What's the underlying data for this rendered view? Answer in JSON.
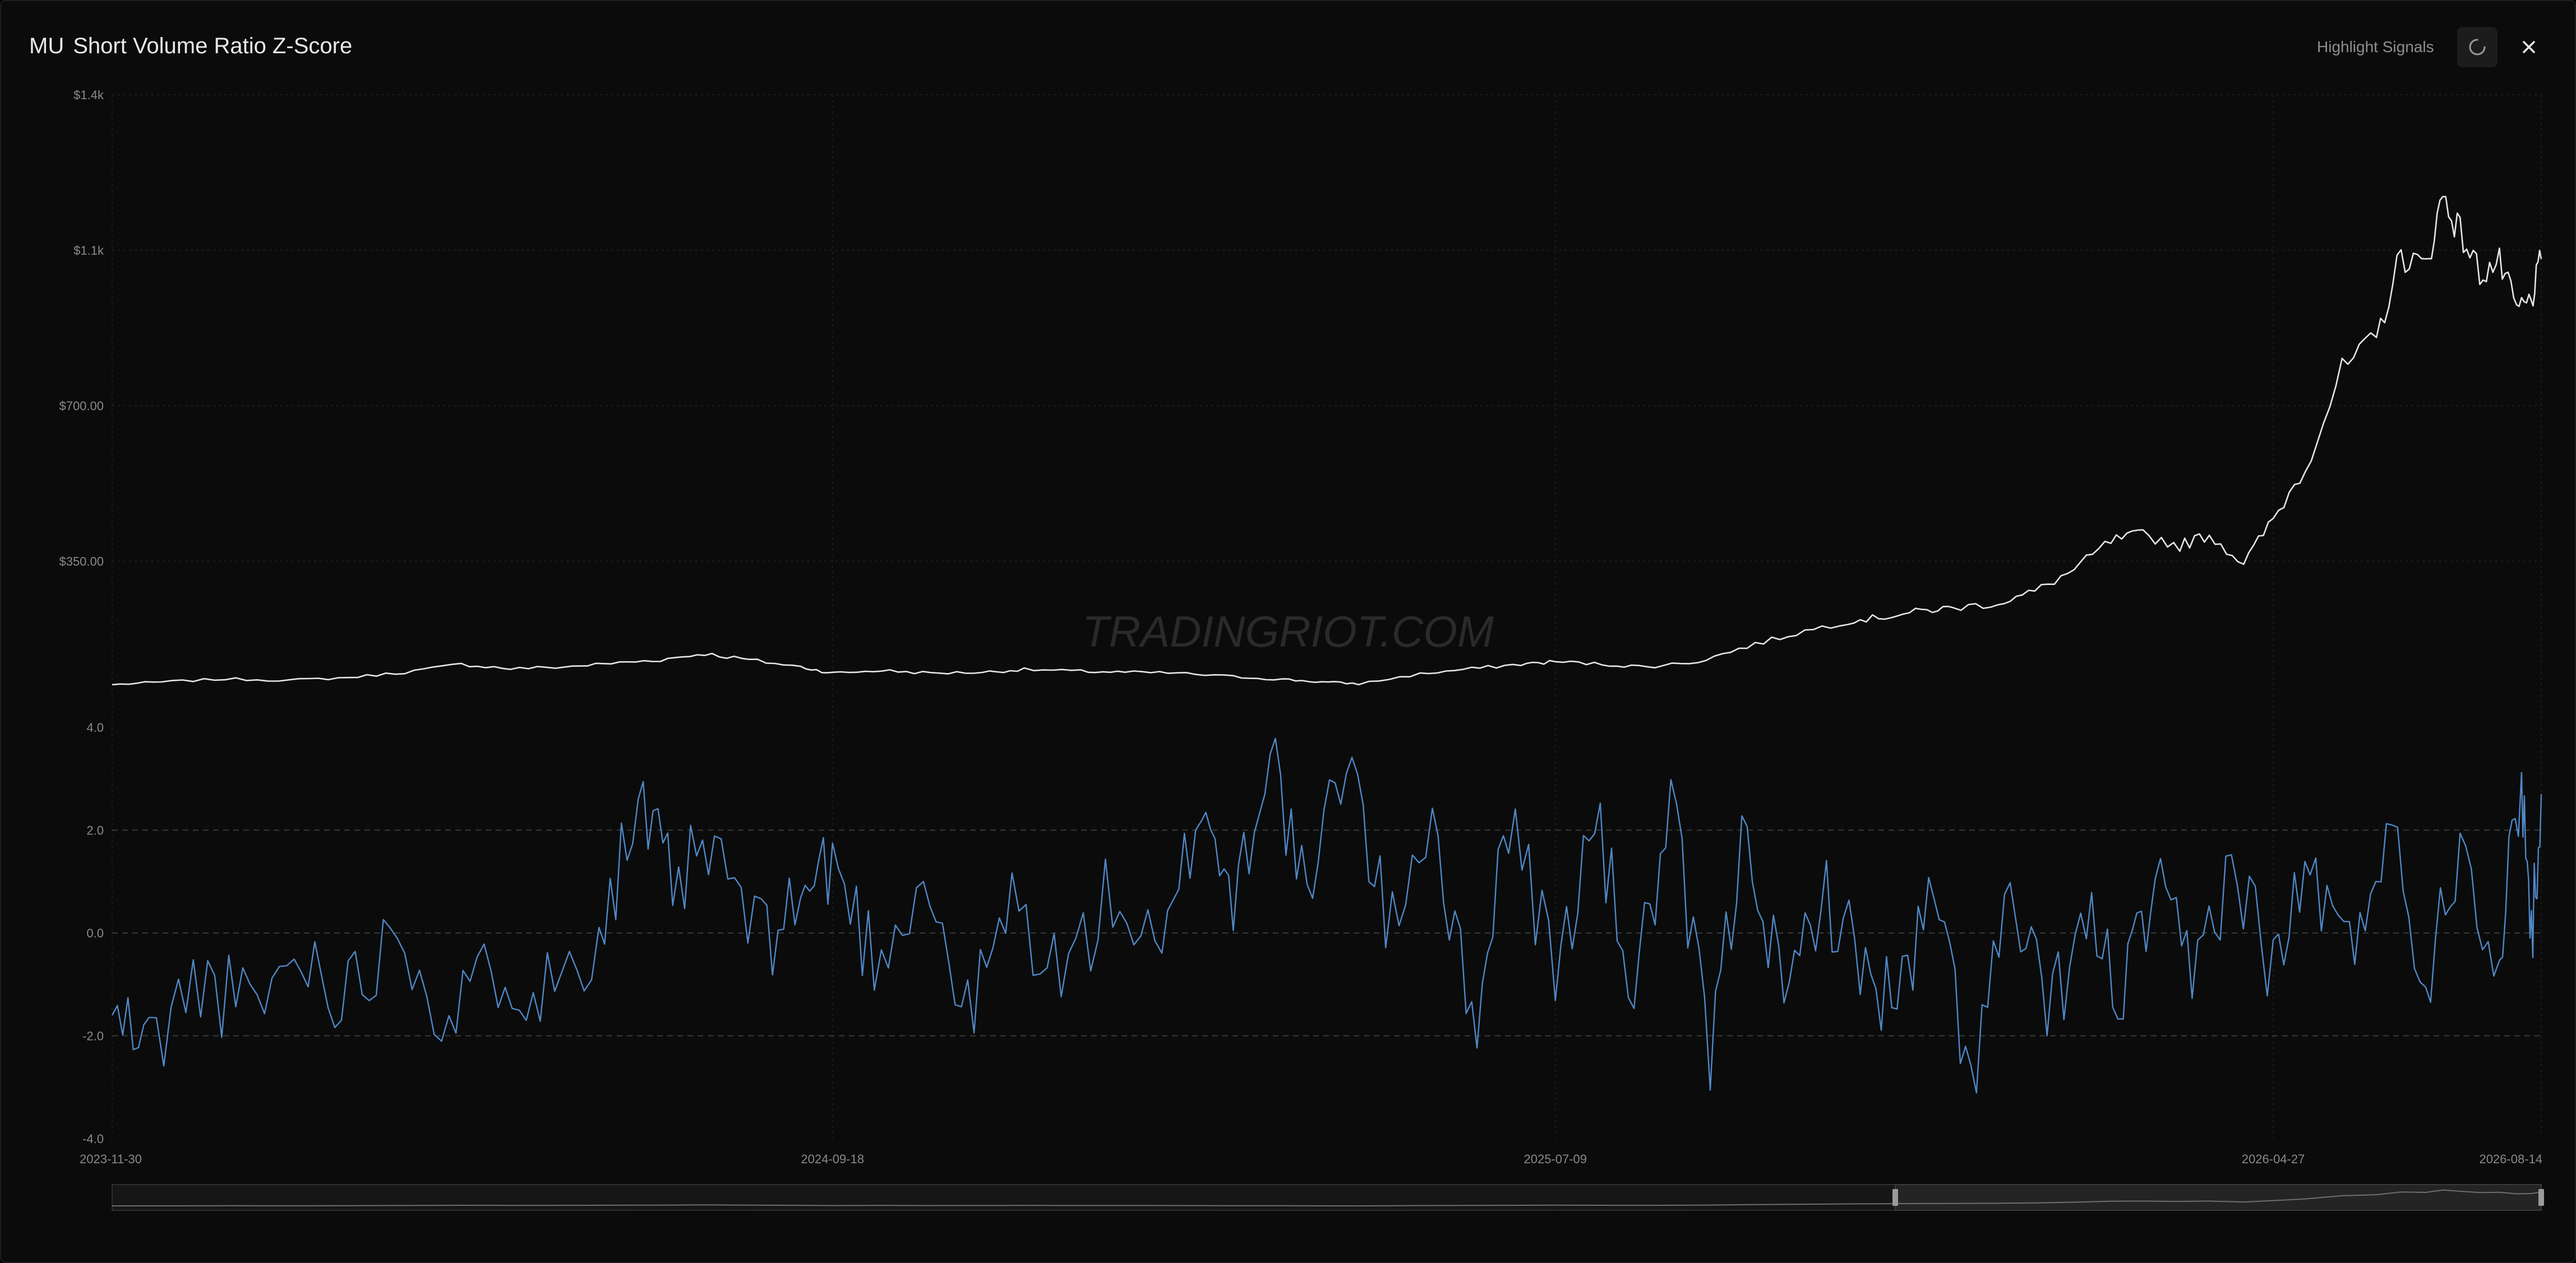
{
  "header": {
    "ticker": "MU",
    "title": "Short Volume Ratio Z-Score",
    "highlight_label": "Highlight Signals",
    "refresh_icon": "refresh-icon",
    "close_icon": "close-icon"
  },
  "watermark": "TRADINGRIOT.COM",
  "colors": {
    "background": "#0b0b0b",
    "price_line": "#e6e6e6",
    "zscore_line": "#4f88c6",
    "grid": "#1c1c1c",
    "axis_text": "#8a8a8a"
  },
  "chart_data": [
    {
      "type": "line",
      "name": "price",
      "y_axis": {
        "ticks": [
          "$1.4k",
          "$1.1k",
          "$700.00",
          "$350.00"
        ],
        "tick_values": [
          1400,
          1050,
          700,
          350
        ],
        "range": [
          0,
          1400
        ]
      },
      "x_range": [
        "2023-11-30",
        "2026-08-14"
      ],
      "points": [
        [
          "2023-11-30",
          72
        ],
        [
          "2023-12-20",
          78
        ],
        [
          "2024-01-15",
          85
        ],
        [
          "2024-02-10",
          82
        ],
        [
          "2024-03-05",
          88
        ],
        [
          "2024-03-28",
          100
        ],
        [
          "2024-04-20",
          118
        ],
        [
          "2024-05-10",
          108
        ],
        [
          "2024-06-01",
          112
        ],
        [
          "2024-06-20",
          120
        ],
        [
          "2024-07-10",
          128
        ],
        [
          "2024-07-28",
          142
        ],
        [
          "2024-08-15",
          128
        ],
        [
          "2024-09-05",
          112
        ],
        [
          "2024-09-18",
          98
        ],
        [
          "2024-10-08",
          104
        ],
        [
          "2024-10-28",
          98
        ],
        [
          "2024-11-18",
          100
        ],
        [
          "2024-12-05",
          106
        ],
        [
          "2024-12-28",
          102
        ],
        [
          "2025-01-15",
          100
        ],
        [
          "2025-02-05",
          98
        ],
        [
          "2025-02-28",
          90
        ],
        [
          "2025-03-20",
          84
        ],
        [
          "2025-04-05",
          78
        ],
        [
          "2025-04-20",
          74
        ],
        [
          "2025-05-15",
          96
        ],
        [
          "2025-06-05",
          108
        ],
        [
          "2025-06-25",
          118
        ],
        [
          "2025-07-09",
          124
        ],
        [
          "2025-07-28",
          118
        ],
        [
          "2025-08-15",
          112
        ],
        [
          "2025-09-05",
          124
        ],
        [
          "2025-09-25",
          158
        ],
        [
          "2025-10-15",
          188
        ],
        [
          "2025-11-05",
          215
        ],
        [
          "2025-11-20",
          225
        ],
        [
          "2025-12-05",
          238
        ],
        [
          "2025-12-18",
          245
        ],
        [
          "2026-01-05",
          255
        ],
        [
          "2026-01-20",
          282
        ],
        [
          "2026-02-05",
          330
        ],
        [
          "2026-02-20",
          395
        ],
        [
          "2026-03-05",
          410
        ],
        [
          "2026-03-20",
          385
        ],
        [
          "2026-04-01",
          410
        ],
        [
          "2026-04-15",
          345
        ],
        [
          "2026-04-27",
          445
        ],
        [
          "2026-05-10",
          560
        ],
        [
          "2026-05-25",
          780
        ],
        [
          "2026-06-08",
          850
        ],
        [
          "2026-06-18",
          1040
        ],
        [
          "2026-06-28",
          1010
        ],
        [
          "2026-07-05",
          1175
        ],
        [
          "2026-07-12",
          1090
        ],
        [
          "2026-07-20",
          1000
        ],
        [
          "2026-07-28",
          1020
        ],
        [
          "2026-08-04",
          915
        ],
        [
          "2026-08-10",
          935
        ],
        [
          "2026-08-14",
          1030
        ]
      ]
    },
    {
      "type": "line",
      "name": "zscore",
      "y_axis": {
        "ticks": [
          "4.0",
          "2.0",
          "0.0",
          "-2.0",
          "-4.0"
        ],
        "tick_values": [
          4,
          2,
          0,
          -2,
          -4
        ],
        "range": [
          -4,
          4
        ]
      },
      "reference_lines": [
        2,
        0,
        -2
      ],
      "x_ticks": [
        "2023-11-30",
        "2024-09-18",
        "2025-07-09",
        "2026-04-27",
        "2026-08-14"
      ],
      "x_range": [
        "2023-11-30",
        "2026-08-14"
      ],
      "points": [
        [
          "2023-11-30",
          -1.6
        ],
        [
          "2023-12-15",
          -2.2
        ],
        [
          "2024-01-05",
          -0.9
        ],
        [
          "2024-01-25",
          -1.5
        ],
        [
          "2024-02-15",
          -0.4
        ],
        [
          "2024-03-05",
          -1.2
        ],
        [
          "2024-03-25",
          0.3
        ],
        [
          "2024-04-15",
          -1.8
        ],
        [
          "2024-05-05",
          -0.6
        ],
        [
          "2024-05-25",
          -1.1
        ],
        [
          "2024-06-15",
          0.1
        ],
        [
          "2024-07-01",
          2.4
        ],
        [
          "2024-07-15",
          0.9
        ],
        [
          "2024-08-01",
          1.6
        ],
        [
          "2024-08-20",
          -0.2
        ],
        [
          "2024-09-05",
          0.7
        ],
        [
          "2024-09-18",
          1.4
        ],
        [
          "2024-10-05",
          -0.5
        ],
        [
          "2024-10-25",
          1.1
        ],
        [
          "2024-11-12",
          -1.7
        ],
        [
          "2024-11-30",
          0.6
        ],
        [
          "2024-12-20",
          -0.9
        ],
        [
          "2025-01-10",
          0.8
        ],
        [
          "2025-01-30",
          -0.7
        ],
        [
          "2025-02-15",
          2.7
        ],
        [
          "2025-02-28",
          0.6
        ],
        [
          "2025-03-15",
          3.7
        ],
        [
          "2025-03-30",
          0.4
        ],
        [
          "2025-04-15",
          3.7
        ],
        [
          "2025-05-01",
          0.1
        ],
        [
          "2025-05-20",
          2.4
        ],
        [
          "2025-06-05",
          -2.0
        ],
        [
          "2025-06-20",
          2.4
        ],
        [
          "2025-07-09",
          -0.8
        ],
        [
          "2025-07-25",
          2.2
        ],
        [
          "2025-08-10",
          -1.1
        ],
        [
          "2025-08-25",
          2.3
        ],
        [
          "2025-09-10",
          -2.4
        ],
        [
          "2025-09-25",
          2.3
        ],
        [
          "2025-10-10",
          -1.6
        ],
        [
          "2025-10-25",
          0.9
        ],
        [
          "2025-11-10",
          -0.6
        ],
        [
          "2025-11-25",
          -1.4
        ],
        [
          "2025-12-10",
          0.7
        ],
        [
          "2025-12-25",
          -2.8
        ],
        [
          "2026-01-10",
          0.6
        ],
        [
          "2026-01-25",
          -1.6
        ],
        [
          "2026-02-10",
          0.2
        ],
        [
          "2026-02-25",
          -1.2
        ],
        [
          "2026-03-10",
          0.8
        ],
        [
          "2026-03-25",
          -0.9
        ],
        [
          "2026-04-10",
          1.4
        ],
        [
          "2026-04-27",
          -0.7
        ],
        [
          "2026-05-12",
          1.3
        ],
        [
          "2026-05-28",
          -0.5
        ],
        [
          "2026-06-12",
          2.2
        ],
        [
          "2026-06-28",
          -0.9
        ],
        [
          "2026-07-12",
          1.9
        ],
        [
          "2026-07-28",
          -0.5
        ],
        [
          "2026-08-06",
          3.1
        ],
        [
          "2026-08-10",
          -0.1
        ],
        [
          "2026-08-14",
          2.7
        ]
      ]
    }
  ]
}
